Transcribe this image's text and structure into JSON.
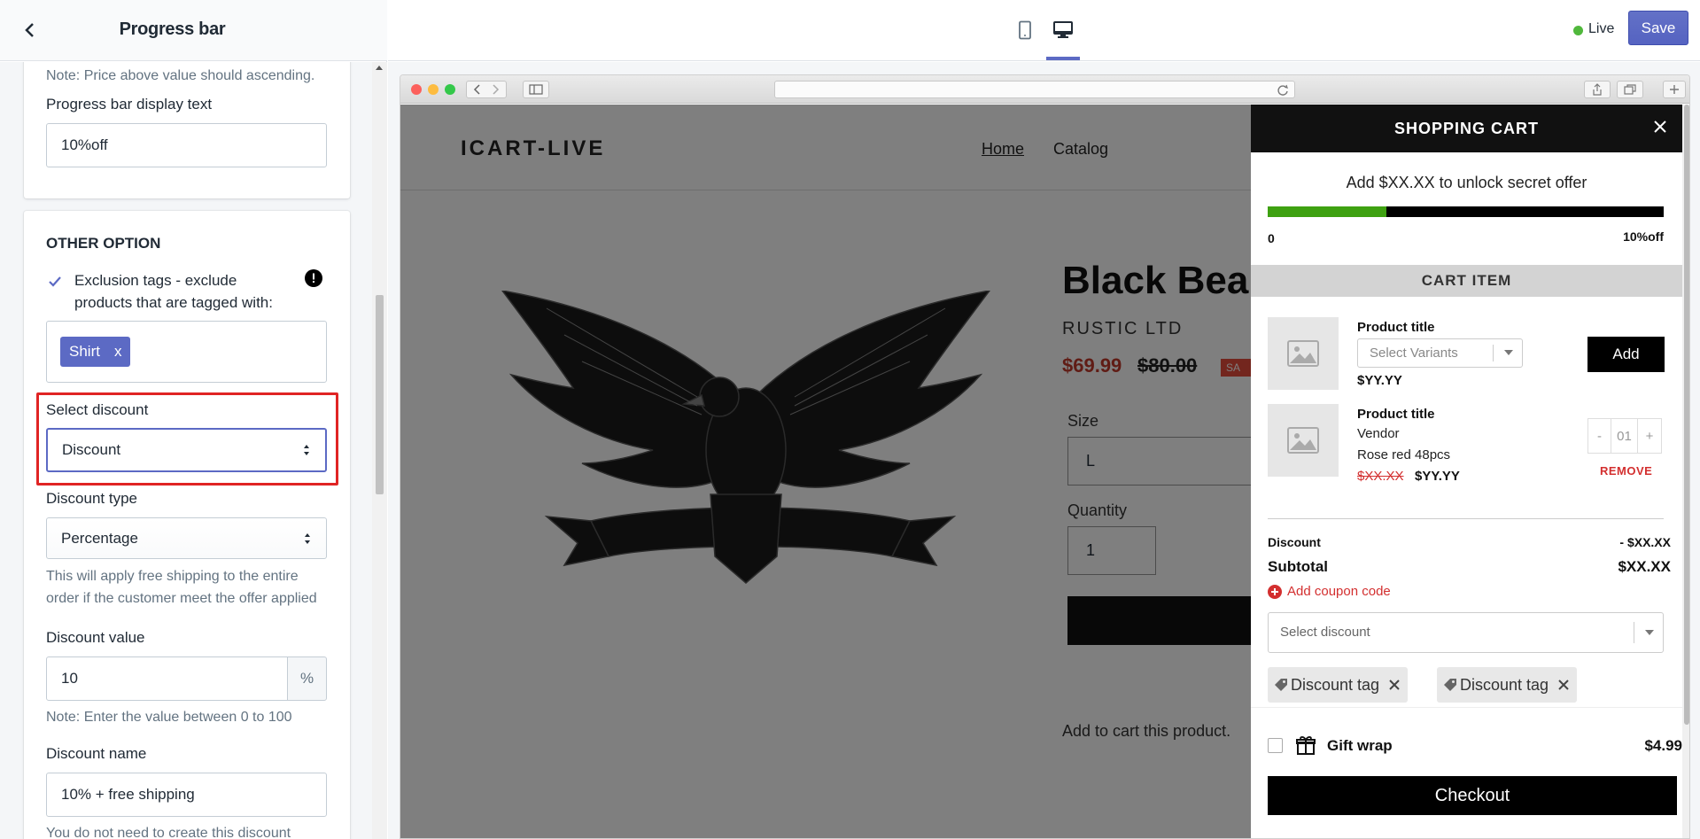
{
  "panel": {
    "title": "Progress bar",
    "price_note": "Note: Price above value should ascending.",
    "display_text_label": "Progress bar display text",
    "display_text_value": "10%off"
  },
  "other_option": {
    "heading": "OTHER OPTION",
    "exclusion_line1": "Exclusion tags  - exclude",
    "exclusion_line2": "products that are tagged with:",
    "exclusion_checked": true,
    "tags": [
      "Shirt"
    ],
    "tag_remove": "x",
    "select_discount_label": "Select discount",
    "select_discount_value": "Discount",
    "discount_type_label": "Discount type",
    "discount_type_value": "Percentage",
    "shipping_note_line1": "This will apply free shipping to the entire",
    "shipping_note_line2": "order if the customer meet the offer applied",
    "discount_value_label": "Discount value",
    "discount_value": "10",
    "discount_value_unit": "%",
    "discount_value_note": "Note: Enter the value between 0 to 100",
    "discount_name_label": "Discount name",
    "discount_name_value": "10% + free shipping",
    "discount_name_note": "You do not need to create this discount"
  },
  "topbar": {
    "live_label": "Live",
    "save_label": "Save",
    "selected_device": "desktop"
  },
  "store": {
    "logo": "ICART-LIVE",
    "nav": [
      "Home",
      "Catalog"
    ],
    "product_title": "Black Bea",
    "vendor": "RUSTIC LTD",
    "price": "$69.99",
    "compare_price": "$80.00",
    "sale_badge": "SA",
    "size_label": "Size",
    "size_value": "L",
    "quantity_label": "Quantity",
    "quantity_value": "1",
    "add_to_cart_text": "Add to cart this product."
  },
  "cart": {
    "title": "SHOPPING CART",
    "goal_text": "Add $XX.XX to unlock secret offer",
    "progress": 0.3,
    "progress_start": "0",
    "progress_end": "10%off",
    "section_label": "CART ITEM",
    "upsell": {
      "title": "Product title",
      "variant_placeholder": "Select Variants",
      "price": "$YY.YY",
      "add_label": "Add"
    },
    "item": {
      "title": "Product title",
      "vendor": "Vendor",
      "variant": "Rose red 48pcs",
      "compare_price": "$XX.XX",
      "price": "$YY.YY",
      "qty_minus": "-",
      "qty": "01",
      "qty_plus": "+",
      "remove_label": "REMOVE"
    },
    "discount_label": "Discount",
    "discount_value": "- $XX.XX",
    "subtotal_label": "Subtotal",
    "subtotal_value": "$XX.XX",
    "coupon_label": "Add coupon code",
    "discount_select_placeholder": "Select discount",
    "discount_tags": [
      "Discount tag",
      "Discount tag"
    ],
    "gift_label": "Gift wrap",
    "gift_price": "$4.99",
    "checkout_label": "Checkout"
  },
  "colors": {
    "accent": "#5c6ac4",
    "progress_fill": "#3ea111",
    "highlight": "#e02424",
    "danger": "#d32f2f"
  }
}
